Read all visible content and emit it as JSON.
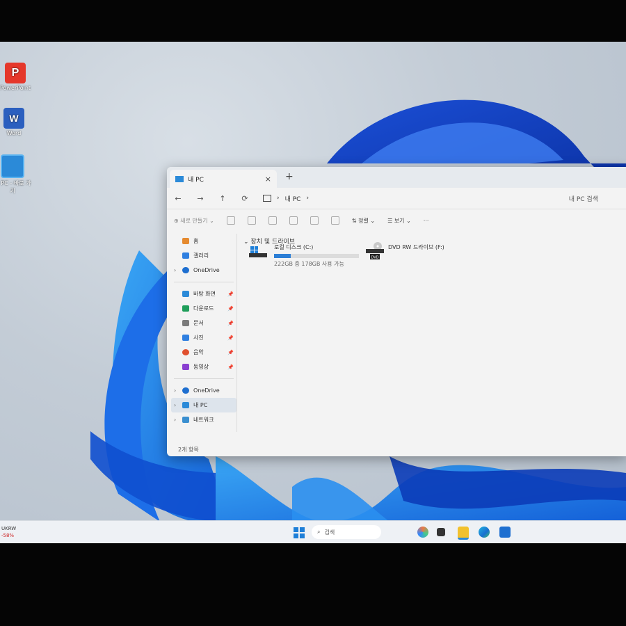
{
  "desktop": {
    "icons": [
      {
        "label": "PowerPoint",
        "glyph": "P"
      },
      {
        "label": "Word",
        "glyph": "W"
      },
      {
        "label": "내 PC - 바로 가기"
      }
    ]
  },
  "explorer": {
    "tab_title": "내 PC",
    "tab_close": "×",
    "new_tab": "+",
    "nav": {
      "back": "←",
      "forward": "→",
      "up": "↑",
      "refresh": "⟳"
    },
    "address": {
      "separator": "›",
      "location": "내 PC",
      "trailing": "›"
    },
    "search_placeholder": "내 PC 검색",
    "toolbar": {
      "new_label": "새로 만들기",
      "sort_label": "정렬",
      "view_label": "보기",
      "more_label": "···"
    },
    "sidebar": {
      "home": "홈",
      "gallery": "갤러리",
      "onedrive_top": "OneDrive",
      "pinned": [
        {
          "label": "바탕 화면",
          "icon": "desktop-icon",
          "color": "#2b8ad8"
        },
        {
          "label": "다운로드",
          "icon": "download-icon",
          "color": "#1f9e5a"
        },
        {
          "label": "문서",
          "icon": "document-icon",
          "color": "#7a7a7a"
        },
        {
          "label": "사진",
          "icon": "pictures-icon",
          "color": "#2f7fe0"
        },
        {
          "label": "음악",
          "icon": "music-icon",
          "color": "#e0502f"
        },
        {
          "label": "동영상",
          "icon": "video-icon",
          "color": "#8a3fd1"
        }
      ],
      "onedrive_bottom": "OneDrive",
      "this_pc": "내 PC",
      "network": "네트워크"
    },
    "section_title": "장치 및 드라이브",
    "drives": [
      {
        "name": "로컬 디스크 (C:)",
        "usage": "222GB 중 178GB 사용 가능",
        "used_fraction": 0.2
      },
      {
        "name": "DVD RW 드라이브 (F:)",
        "badge": "DVD"
      }
    ],
    "status": "2개 항목"
  },
  "taskbar": {
    "left_line1": "UKRW",
    "left_line2": "-58%",
    "search_label": "검색"
  }
}
